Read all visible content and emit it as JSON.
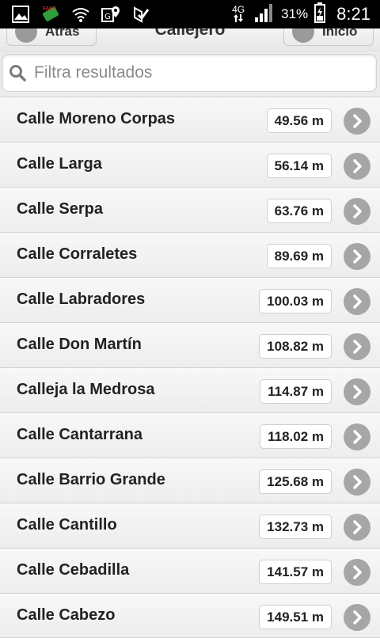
{
  "status_bar": {
    "network": "4G",
    "battery": "31%",
    "time": "8:21",
    "icons": [
      "image-icon",
      "fake-gps-icon",
      "wifi-icon",
      "gps-icon",
      "check-icon"
    ]
  },
  "header": {
    "back_label": "Atrás",
    "title": "Callejero",
    "home_label": "Inicio"
  },
  "search": {
    "placeholder": "Filtra resultados",
    "value": ""
  },
  "streets": [
    {
      "name": "Calle Moreno Corpas",
      "distance": "49.56 m"
    },
    {
      "name": "Calle Larga",
      "distance": "56.14 m"
    },
    {
      "name": "Calle Serpa",
      "distance": "63.76 m"
    },
    {
      "name": "Calle Corraletes",
      "distance": "89.69 m"
    },
    {
      "name": "Calle Labradores",
      "distance": "100.03 m"
    },
    {
      "name": "Calle Don Martín",
      "distance": "108.82 m"
    },
    {
      "name": "Calleja la Medrosa",
      "distance": "114.87 m"
    },
    {
      "name": "Calle Cantarrana",
      "distance": "118.02 m"
    },
    {
      "name": "Calle Barrio Grande",
      "distance": "125.68 m"
    },
    {
      "name": "Calle Cantillo",
      "distance": "132.73 m"
    },
    {
      "name": "Calle Cebadilla",
      "distance": "141.57 m"
    },
    {
      "name": "Calle Cabezo",
      "distance": "149.51 m"
    }
  ]
}
